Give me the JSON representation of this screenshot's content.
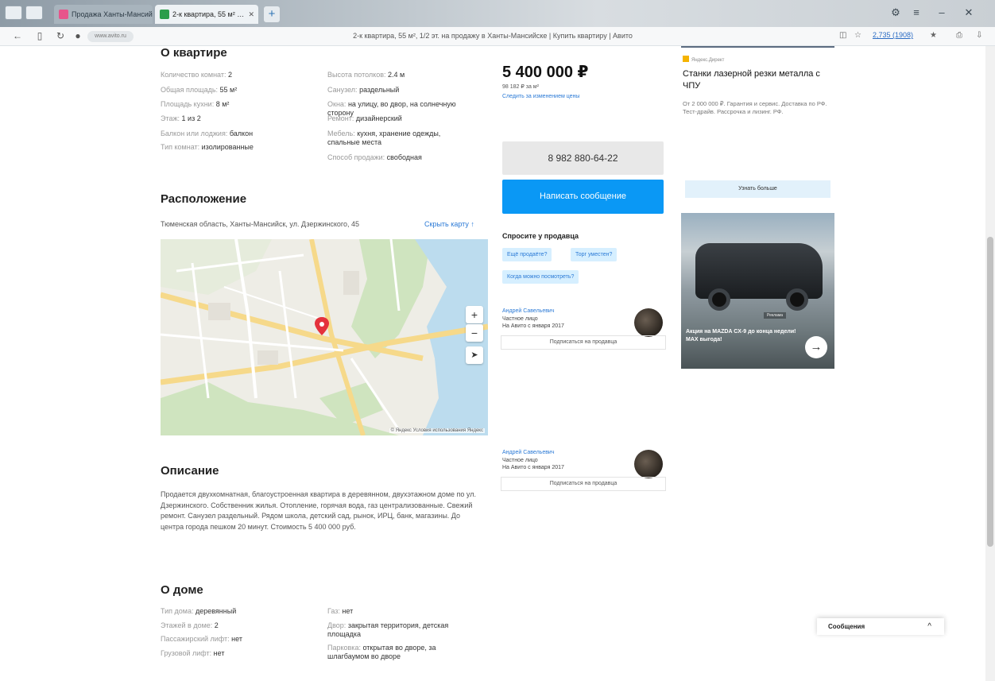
{
  "browser": {
    "tabs": [
      {
        "title": "Продажа Ханты-Мансийск — Ав…",
        "active": false
      },
      {
        "title": "2-к квартира, 55 м² …",
        "active": true
      }
    ],
    "new_tab": "+",
    "address_chip": "www.avito.ru",
    "page_title": "2-к квартира, 55 м², 1/2 эт. на продажу в Ханты-Мансийске | Купить квартиру | Авито",
    "right_link": "2,735 (1908)",
    "win_controls": [
      "⚙",
      "≡",
      "–",
      "✕"
    ]
  },
  "about": {
    "title": "О квартире",
    "left": [
      {
        "k": "Количество комнат:",
        "v": "2"
      },
      {
        "k": "Общая площадь:",
        "v": "55 м²"
      },
      {
        "k": "Площадь кухни:",
        "v": "8 м²"
      },
      {
        "k": "Этаж:",
        "v": "1 из 2"
      },
      {
        "k": "Балкон или лоджия:",
        "v": "балкон"
      },
      {
        "k": "Тип комнат:",
        "v": "изолированные"
      }
    ],
    "right": [
      {
        "k": "Высота потолков:",
        "v": "2.4 м"
      },
      {
        "k": "Санузел:",
        "v": "раздельный"
      },
      {
        "k": "Окна:",
        "v": "на улицу, во двор, на солнечную сторону"
      },
      {
        "k": "Ремонт:",
        "v": "дизайнерский"
      },
      {
        "k": "Мебель:",
        "v": "кухня, хранение одежды, спальные места"
      },
      {
        "k": "Способ продажи:",
        "v": "свободная"
      }
    ]
  },
  "location": {
    "title": "Расположение",
    "address": "Тюменская область, Ханты-Мансийск, ул. Дзержинского, 45",
    "show_map": "Скрыть карту ↑",
    "map_copyright": "© Яндекс  Условия использования  Яндекс"
  },
  "description": {
    "title": "Описание",
    "text": "Продается двухкомнатная, благоустроенная квартира в деревянном, двухэтажном доме по ул. Дзержинского. Собственник жилья. Отопление, горячая вода, газ централизованные. Свежий ремонт. Санузел раздельный. Рядом школа, детский сад, рынок, ИРЦ, банк, магазины. До центра города пешком 20 минут. Стоимость 5 400 000 руб."
  },
  "house": {
    "title": "О доме",
    "left": [
      {
        "k": "Тип дома:",
        "v": "деревянный"
      },
      {
        "k": "Этажей в доме:",
        "v": "2"
      },
      {
        "k": "Пассажирский лифт:",
        "v": "нет"
      },
      {
        "k": "Грузовой лифт:",
        "v": "нет"
      }
    ],
    "right": [
      {
        "k": "Газ:",
        "v": "нет"
      },
      {
        "k": "Двор:",
        "v": "закрытая территория, детская площадка"
      },
      {
        "k": "Парковка:",
        "v": "открытая во дворе, за шлагбаумом во дворе"
      }
    ]
  },
  "sidebar": {
    "price": "5 400 000 ₽",
    "price_per_m2": "98 182 ₽ за м²",
    "price_history": "Следить за изменением цены",
    "phone": "8 982 880-64-22",
    "write_message": "Написать сообщение",
    "ask_title": "Спросите у продавца",
    "chips": [
      "Ещё продаёте?",
      "Торг уместен?",
      "Когда можно посмотреть?"
    ],
    "sellers": [
      {
        "name": "Андрей Савельевич",
        "type": "Частное лицо",
        "since": "На Авито с января 2017",
        "subscribe": "Подписаться на продавца"
      },
      {
        "name": "Андрей Савельевич",
        "type": "Частное лицо",
        "since": "На Авито с января 2017",
        "subscribe": "Подписаться на продавца"
      }
    ]
  },
  "ads": {
    "ad1": {
      "source": "Яндекс.Директ",
      "title": "Станки лазерной резки металла с ЧПУ",
      "text": "От 2 000 000 ₽. Гарантия и сервис. Доставка по РФ. Тест-драйв. Рассрочка и лизинг. РФ.",
      "button": "Узнать больше"
    },
    "ad2": {
      "label": "Реклама",
      "caption": "Акция на MAZDA CX-9 до конца недели! МАХ выгода!",
      "arrow": "→"
    }
  },
  "messenger": {
    "label": "Сообщения",
    "chevron": "^"
  }
}
